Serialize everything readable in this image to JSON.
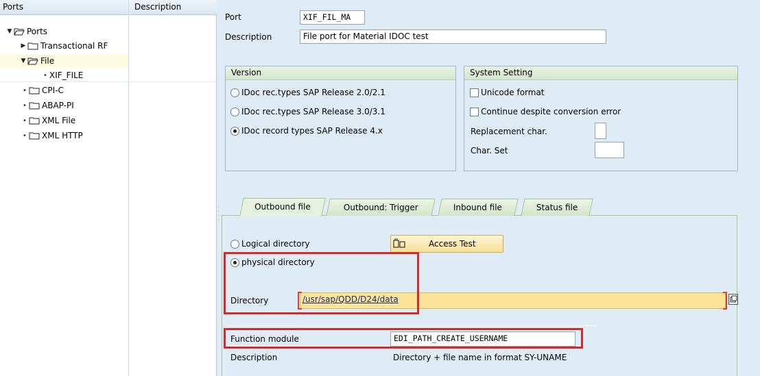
{
  "tree": {
    "columns": [
      "Ports",
      "Description"
    ],
    "nodes": [
      {
        "label": "Ports",
        "expanded": true
      },
      {
        "label": "Transactional RF",
        "expanded": false
      },
      {
        "label": "File",
        "expanded": true
      },
      {
        "label": "XIF_FILE"
      },
      {
        "label": "CPI-C"
      },
      {
        "label": "ABAP-PI"
      },
      {
        "label": "XML File"
      },
      {
        "label": "XML HTTP"
      }
    ]
  },
  "header": {
    "port_label": "Port",
    "port_value": "XIF_FIL_MA",
    "description_label": "Description",
    "description_value": "File port for Material IDOC test"
  },
  "version": {
    "title": "Version",
    "options": [
      {
        "label": "IDoc rec.types SAP Release 2.0/2.1",
        "selected": false
      },
      {
        "label": "IDoc rec.types SAP Release 3.0/3.1",
        "selected": false
      },
      {
        "label": "IDoc record types SAP Release 4.x",
        "selected": true
      }
    ]
  },
  "system_setting": {
    "title": "System Setting",
    "unicode_label": "Unicode format",
    "continue_label": "Continue despite conversion error",
    "replacement_label": "Replacement char.",
    "charset_label": "Char. Set"
  },
  "tabs": [
    {
      "label": "Outbound file",
      "active": true
    },
    {
      "label": "Outbound: Trigger",
      "active": false
    },
    {
      "label": "Inbound file",
      "active": false
    },
    {
      "label": "Status file",
      "active": false
    }
  ],
  "outbound": {
    "logical_label": "Logical directory",
    "physical_label": "physical directory",
    "access_test_label": "Access Test",
    "directory_label": "Directory",
    "directory_value": "/usr/sap/QDD/D24/data",
    "function_module_label": "Function module",
    "function_module_value": "EDI_PATH_CREATE_USERNAME",
    "fm_description_label": "Description",
    "fm_description_value": "Directory + file name in format SY-UNAME"
  },
  "colors": {
    "accent_red": "#d42a2a",
    "highlight_yellow": "#fbe49a",
    "panel_bg": "#dfebf5"
  }
}
